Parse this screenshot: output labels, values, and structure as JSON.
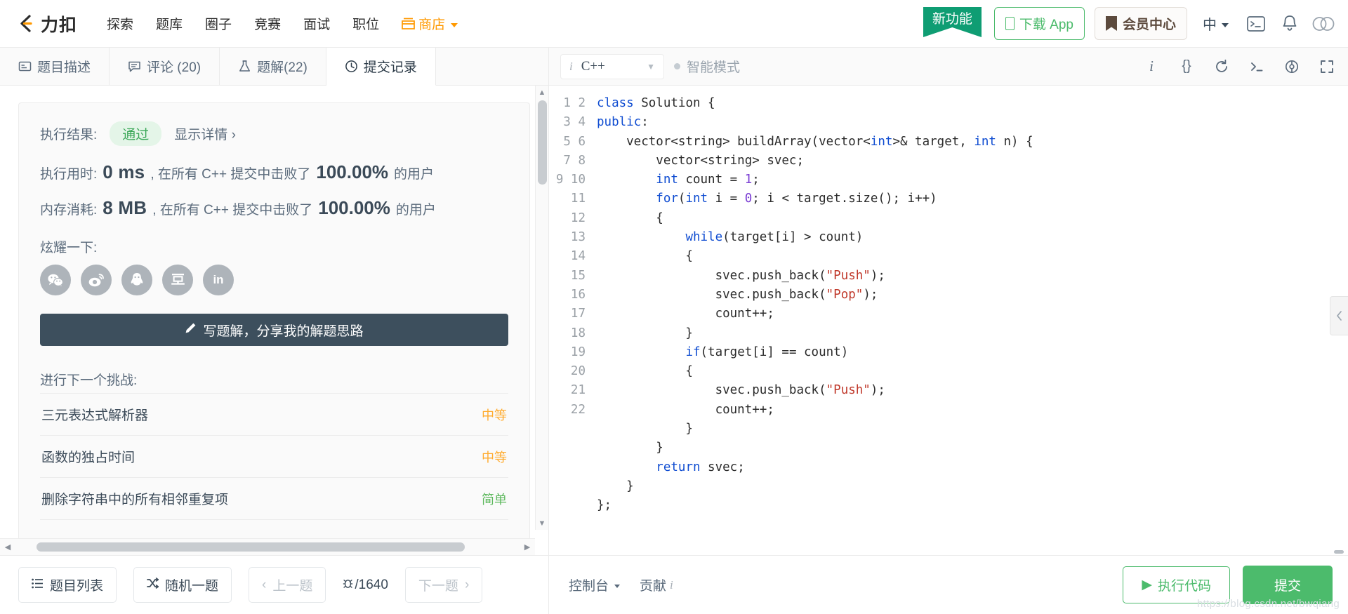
{
  "nav": {
    "brand": "力扣",
    "links": [
      "探索",
      "题库",
      "圈子",
      "竞赛",
      "面试",
      "职位"
    ],
    "shop_label": "商店",
    "ribbon": "新功能",
    "download_app": "下载 App",
    "membership": "会员中心",
    "lang": "中"
  },
  "tabs": [
    {
      "label": "题目描述",
      "icon": "description-icon",
      "active": false
    },
    {
      "label": "评论 (20)",
      "icon": "comment-icon",
      "active": false
    },
    {
      "label": "题解(22)",
      "icon": "flask-icon",
      "active": false
    },
    {
      "label": "提交记录",
      "icon": "clock-icon",
      "active": true
    }
  ],
  "result": {
    "result_label": "执行结果:",
    "status": "通过",
    "detail_link": "显示详情",
    "detail_chevron": "›",
    "runtime": {
      "label": "执行用时:",
      "value": "0 ms",
      "mid": ", 在所有 C++ 提交中击败了",
      "percent": "100.00%",
      "suffix": "的用户"
    },
    "memory": {
      "label": "内存消耗:",
      "value": "8 MB",
      "mid": ", 在所有 C++ 提交中击败了",
      "percent": "100.00%",
      "suffix": "的用户"
    },
    "brag_label": "炫耀一下:",
    "share": [
      {
        "name": "wechat-share-icon",
        "glyph": "💬"
      },
      {
        "name": "weibo-share-icon",
        "glyph": "◉"
      },
      {
        "name": "qq-share-icon",
        "glyph": "🐧"
      },
      {
        "name": "douban-share-icon",
        "glyph": "豆"
      },
      {
        "name": "linkedin-share-icon",
        "glyph": "in"
      }
    ],
    "write_solution": "写题解，分享我的解题思路",
    "next_challenge_title": "进行下一个挑战:",
    "challenges": [
      {
        "title": "三元表达式解析器",
        "difficulty": "中等",
        "level": "medium"
      },
      {
        "title": "函数的独占时间",
        "difficulty": "中等",
        "level": "medium"
      },
      {
        "title": "删除字符串中的所有相邻重复项",
        "difficulty": "简单",
        "level": "easy"
      }
    ]
  },
  "editor": {
    "language": "C++",
    "info_glyph": "i",
    "smart_mode": "智能模式",
    "tools": [
      {
        "name": "info-icon",
        "glyph": "i"
      },
      {
        "name": "format-braces-icon",
        "glyph": "{}"
      },
      {
        "name": "reset-icon",
        "glyph": "↺"
      },
      {
        "name": "terminal-icon",
        "glyph": ">_"
      },
      {
        "name": "settings-icon",
        "glyph": "⚙"
      },
      {
        "name": "fullscreen-icon",
        "glyph": "⛶"
      }
    ],
    "line_count": 22,
    "code_lines": [
      "class Solution {",
      "public:",
      "    vector<string> buildArray(vector<int>& target, int n) {",
      "        vector<string> svec;",
      "        int count = 1;",
      "        for(int i = 0; i < target.size(); i++)",
      "        {",
      "            while(target[i] > count)",
      "            {",
      "                svec.push_back(\"Push\");",
      "                svec.push_back(\"Pop\");",
      "                count++;",
      "            }",
      "            if(target[i] == count)",
      "            {",
      "                svec.push_back(\"Push\");",
      "                count++;",
      "            }",
      "        }",
      "        return svec;",
      "    }",
      "};"
    ]
  },
  "footer": {
    "problem_list": "题目列表",
    "random_problem": "随机一题",
    "prev_problem": "上一题",
    "pager": "/1640",
    "next_problem": "下一题",
    "console": "控制台",
    "contribute": "贡献",
    "contribute_info": "i",
    "run_code": "执行代码",
    "submit": "提交"
  },
  "watermark": "https://blog.csdn.net/bwqiang",
  "colors": {
    "brand_orange": "#f90",
    "green": "#4cbb6c",
    "ribbon_green": "#0f9d73",
    "pass_bg": "#e4f5e8",
    "pass_text": "#3aa757",
    "slate": "#3d4f5d",
    "medium": "#ffab2e",
    "easy": "#5cb85c"
  }
}
